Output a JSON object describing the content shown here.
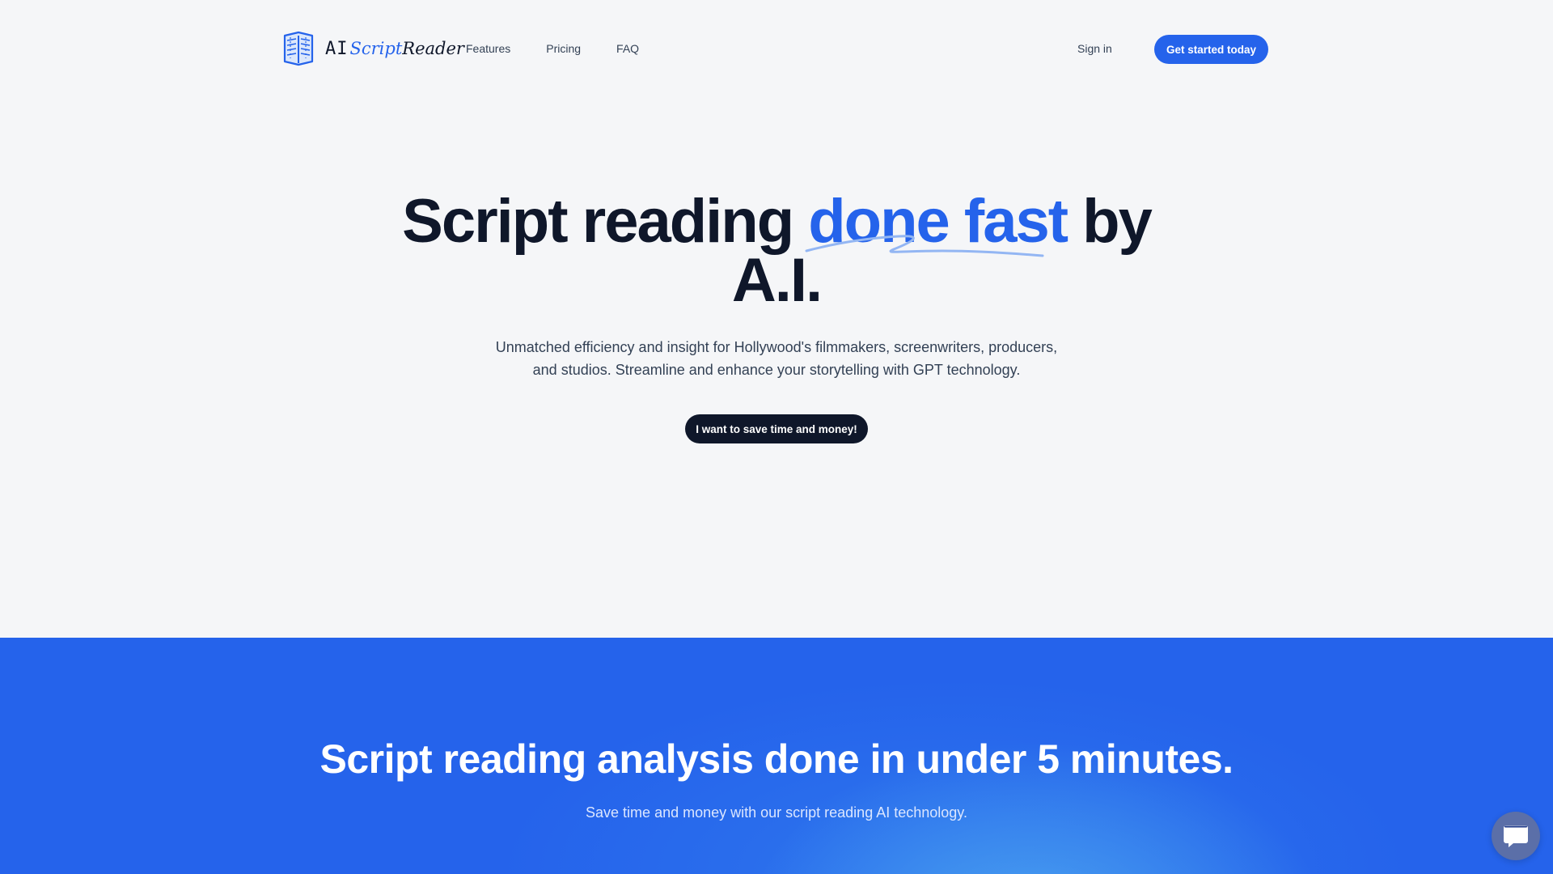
{
  "logo": {
    "ai": "AI",
    "script": "Script",
    "reader": "Reader"
  },
  "nav": {
    "items": [
      {
        "label": "Features"
      },
      {
        "label": "Pricing"
      },
      {
        "label": "FAQ"
      }
    ],
    "sign_in": "Sign in",
    "cta": "Get started today"
  },
  "hero": {
    "title_part1": "Script reading ",
    "title_highlight": "done fast",
    "title_part2": " by",
    "title_line2": "A.I.",
    "subtitle_line1": "Unmatched efficiency and insight for Hollywood's filmmakers, screenwriters, producers,",
    "subtitle_line2": "and studios. Streamline and enhance your storytelling with GPT technology.",
    "cta": "I want to save time and money!"
  },
  "section2": {
    "title": "Script reading analysis done in under 5 minutes.",
    "subtitle": "Save time and money with our script reading AI technology."
  },
  "icons": {
    "logo": "book-icon",
    "chat": "chat-bubble-icon"
  },
  "colors": {
    "accent": "#2563eb",
    "dark": "#0f172a",
    "background": "#f5f6f8",
    "chat_button": "#5b6fa8"
  }
}
